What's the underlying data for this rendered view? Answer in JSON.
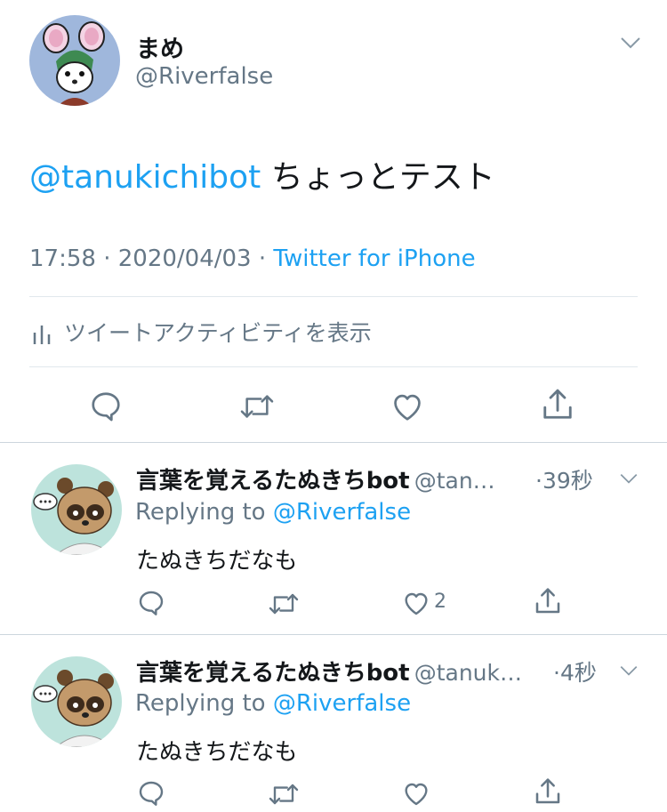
{
  "main_tweet": {
    "author_name": "まめ",
    "author_handle": "@Riverfalse",
    "mention": "@tanukichibot",
    "text": "ちょっとテスト",
    "time": "17:58",
    "sep1": "·",
    "date": "2020/04/03",
    "sep2": "·",
    "source": "Twitter for iPhone",
    "activity_label": "ツイートアクティビティを表示"
  },
  "replies": [
    {
      "name": "言葉を覚えるたぬきちbot",
      "handle": "@tan…",
      "time": "·39秒",
      "replying_prefix": "Replying to",
      "replying_to": "@Riverfalse",
      "text": "たぬきちだなも",
      "like_count": "2"
    },
    {
      "name": "言葉を覚えるたぬきちbot",
      "handle": "@tanuk…",
      "time": "·4秒",
      "replying_prefix": "Replying to",
      "replying_to": "@Riverfalse",
      "text": "たぬきちだなも",
      "like_count": ""
    }
  ],
  "icons": {
    "reply": "reply-icon",
    "retweet": "retweet-icon",
    "like": "heart-icon",
    "share": "share-icon",
    "menu": "chevron-down-icon",
    "activity": "bar-chart-icon"
  },
  "colors": {
    "accent": "#1da1f2",
    "text": "#14171a",
    "secondary": "#657786",
    "divider": "#e1e8ed"
  }
}
